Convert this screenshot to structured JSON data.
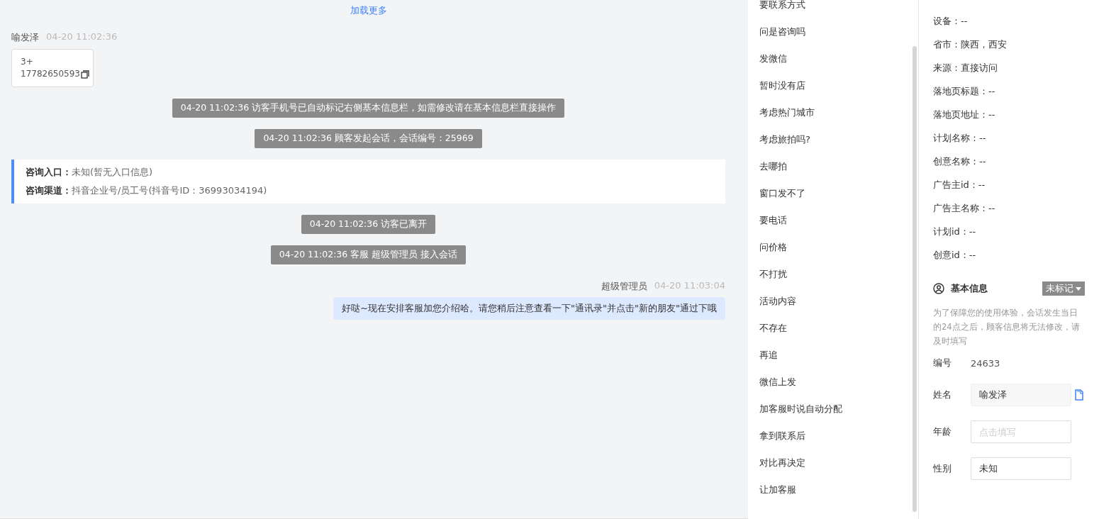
{
  "chat": {
    "load_more": "加载更多",
    "messages": [
      {
        "kind": "visitor_card",
        "sender": "喻发泽",
        "time": "04-20 11:02:36",
        "lines": [
          "3+",
          "17782650593"
        ]
      },
      {
        "kind": "system",
        "text": "04-20 11:02:36 访客手机号已自动标记右侧基本信息栏，如需修改请在基本信息栏直接操作"
      },
      {
        "kind": "system",
        "text": "04-20 11:02:36 顾客发起会话，会话编号：25969"
      },
      {
        "kind": "info",
        "rows": [
          {
            "label": "咨询入口：",
            "value": "未知(暂无入口信息)"
          },
          {
            "label": "咨询渠道：",
            "value": "抖音企业号/员工号(抖音号ID：36993034194)"
          }
        ]
      },
      {
        "kind": "system",
        "text": "04-20 11:02:36 访客已离开"
      },
      {
        "kind": "system",
        "text": "04-20 11:02:36 客服 超级管理员 接入会话"
      },
      {
        "kind": "agent",
        "sender": "超级管理员",
        "time": "04-20 11:03:04",
        "text": "好哒~现在安排客服加您介绍哈。请您稍后注意查看一下\"通讯录\"并点击\"新的朋友\"通过下哦"
      }
    ]
  },
  "quick_replies": [
    "要联系方式",
    "问是咨询吗",
    "发微信",
    "暂时没有店",
    "考虑热门城市",
    "考虑旅拍吗?",
    "去哪拍",
    "窗口发不了",
    "要电话",
    "问价格",
    "不打扰",
    "活动内容",
    "不存在",
    "再追",
    "微信上发",
    "加客服时说自动分配",
    "拿到联系后",
    "对比再决定",
    "让加客服"
  ],
  "visit_info": [
    "设备：--",
    "省市：陕西，西安",
    "来源：直接访问",
    "落地页标题：--",
    "落地页地址：--",
    "计划名称：--",
    "创意名称：--",
    "广告主id：--",
    "广告主名称：--",
    "计划id：--",
    "创意id：--"
  ],
  "basic_info": {
    "title": "基本信息",
    "tag": "未标记",
    "note": "为了保障您的使用体验，会话发生当日的24点之后，顾客信息将无法修改，请及时填写",
    "id_label": "编号",
    "id_value": "24633",
    "fields": [
      {
        "label": "姓名",
        "value": "喻发泽",
        "readonly": true
      },
      {
        "label": "年龄",
        "placeholder": "点击填写",
        "readonly": false
      },
      {
        "label": "性别",
        "value": "未知",
        "readonly": false
      }
    ]
  }
}
